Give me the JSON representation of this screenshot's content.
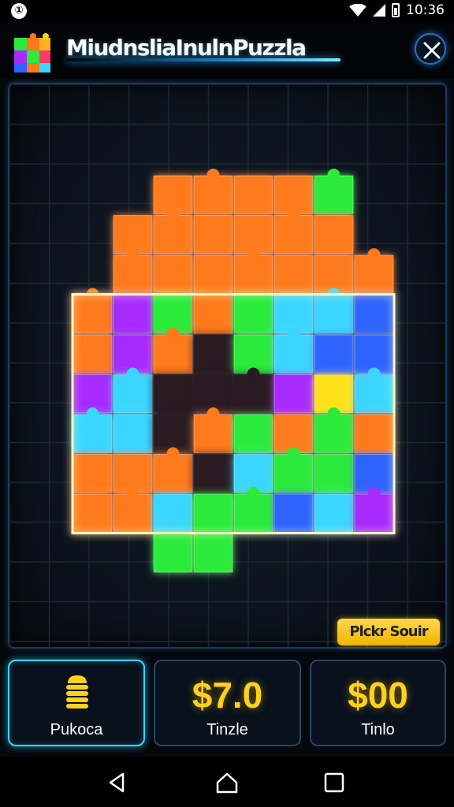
{
  "status_bar": {
    "left_icon": "notification-icon",
    "left_glyph": "①",
    "time": "10:36",
    "icons": [
      "wifi-icon",
      "signal-icon",
      "battery-icon"
    ]
  },
  "header": {
    "title": "MiudnsliaInulnPuzzla",
    "logo_icon": "puzzle-cube-logo-icon",
    "close_icon": "close-icon",
    "accent_color": "#1fa7ff"
  },
  "board": {
    "pick_button_label": "Plckr Souir",
    "glow_colors": [
      "#ff7a1a",
      "#2bea3a",
      "#3ad6ff",
      "#a72bff",
      "#ffe21a",
      "#2e63ff"
    ]
  },
  "tiles": [
    {
      "icon": "coin-stack-icon",
      "value": "",
      "label": "Pukoca",
      "active": true
    },
    {
      "icon": "",
      "value": "$7.0",
      "label": "Tinzle",
      "active": false
    },
    {
      "icon": "",
      "value": "$00",
      "label": "Tinlo",
      "active": false
    }
  ],
  "nav_bar": {
    "icons": [
      "back-icon",
      "home-icon",
      "recents-icon"
    ]
  }
}
